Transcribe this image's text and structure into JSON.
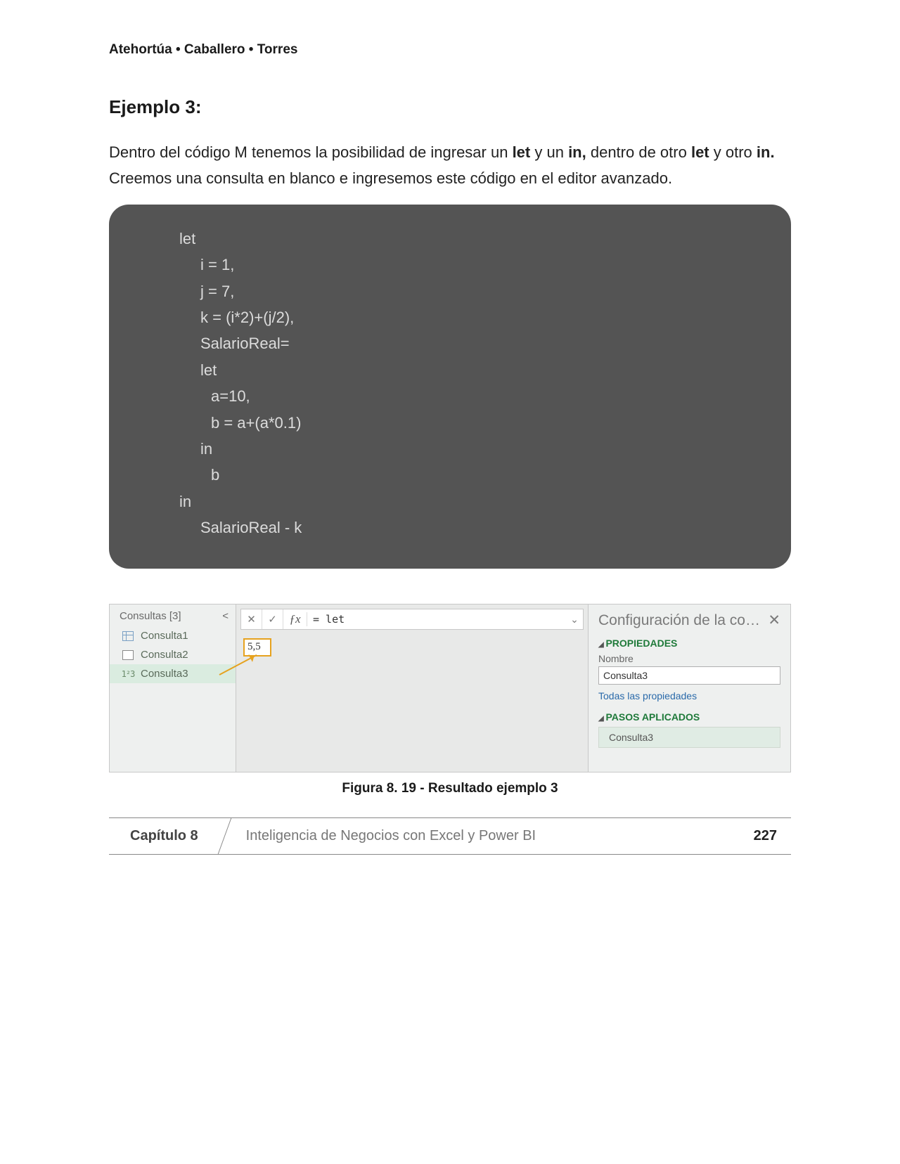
{
  "header": {
    "authors": "Atehortúa • Caballero • Torres"
  },
  "example": {
    "heading": "Ejemplo 3:",
    "para_a": "Dentro del código M tenemos la posibilidad de ingresar un ",
    "para_b": " y un ",
    "para_c": " dentro de otro ",
    "para_d": " y otro ",
    "para_e": " Creemos una consulta en blanco e ingresemos este código en el editor avanzado.",
    "bold_let": "let",
    "bold_in": "in,",
    "bold_let2": "let",
    "bold_in2": "in."
  },
  "code": {
    "l1": "let",
    "l2": "i = 1,",
    "l3": "j = 7,",
    "l4": "k = (i*2)+(j/2),",
    "l5": "",
    "l6": "SalarioReal=",
    "l7": "let",
    "l8": "a=10,",
    "l9": "b = a+(a*0.1)",
    "l10": "in",
    "l11": "b",
    "l12": "in",
    "l13": "SalarioReal - k"
  },
  "pq": {
    "queries_header": "Consultas [3]",
    "collapse": "<",
    "items": [
      {
        "label": "Consulta1"
      },
      {
        "label": "Consulta2"
      },
      {
        "label": "Consulta3"
      }
    ],
    "formula_prefix": "= let",
    "result_value": "5,5",
    "settings_title": "Configuración de la co…",
    "sec_props": "PROPIEDADES",
    "name_label": "Nombre",
    "name_value": "Consulta3",
    "all_props": "Todas las propiedades",
    "sec_steps": "PASOS APLICADOS",
    "step1": "Consulta3"
  },
  "figure_caption": "Figura 8. 19 - Resultado ejemplo 3",
  "footer": {
    "chapter": "Capítulo 8",
    "title": "Inteligencia de Negocios con Excel y Power BI",
    "page": "227"
  }
}
